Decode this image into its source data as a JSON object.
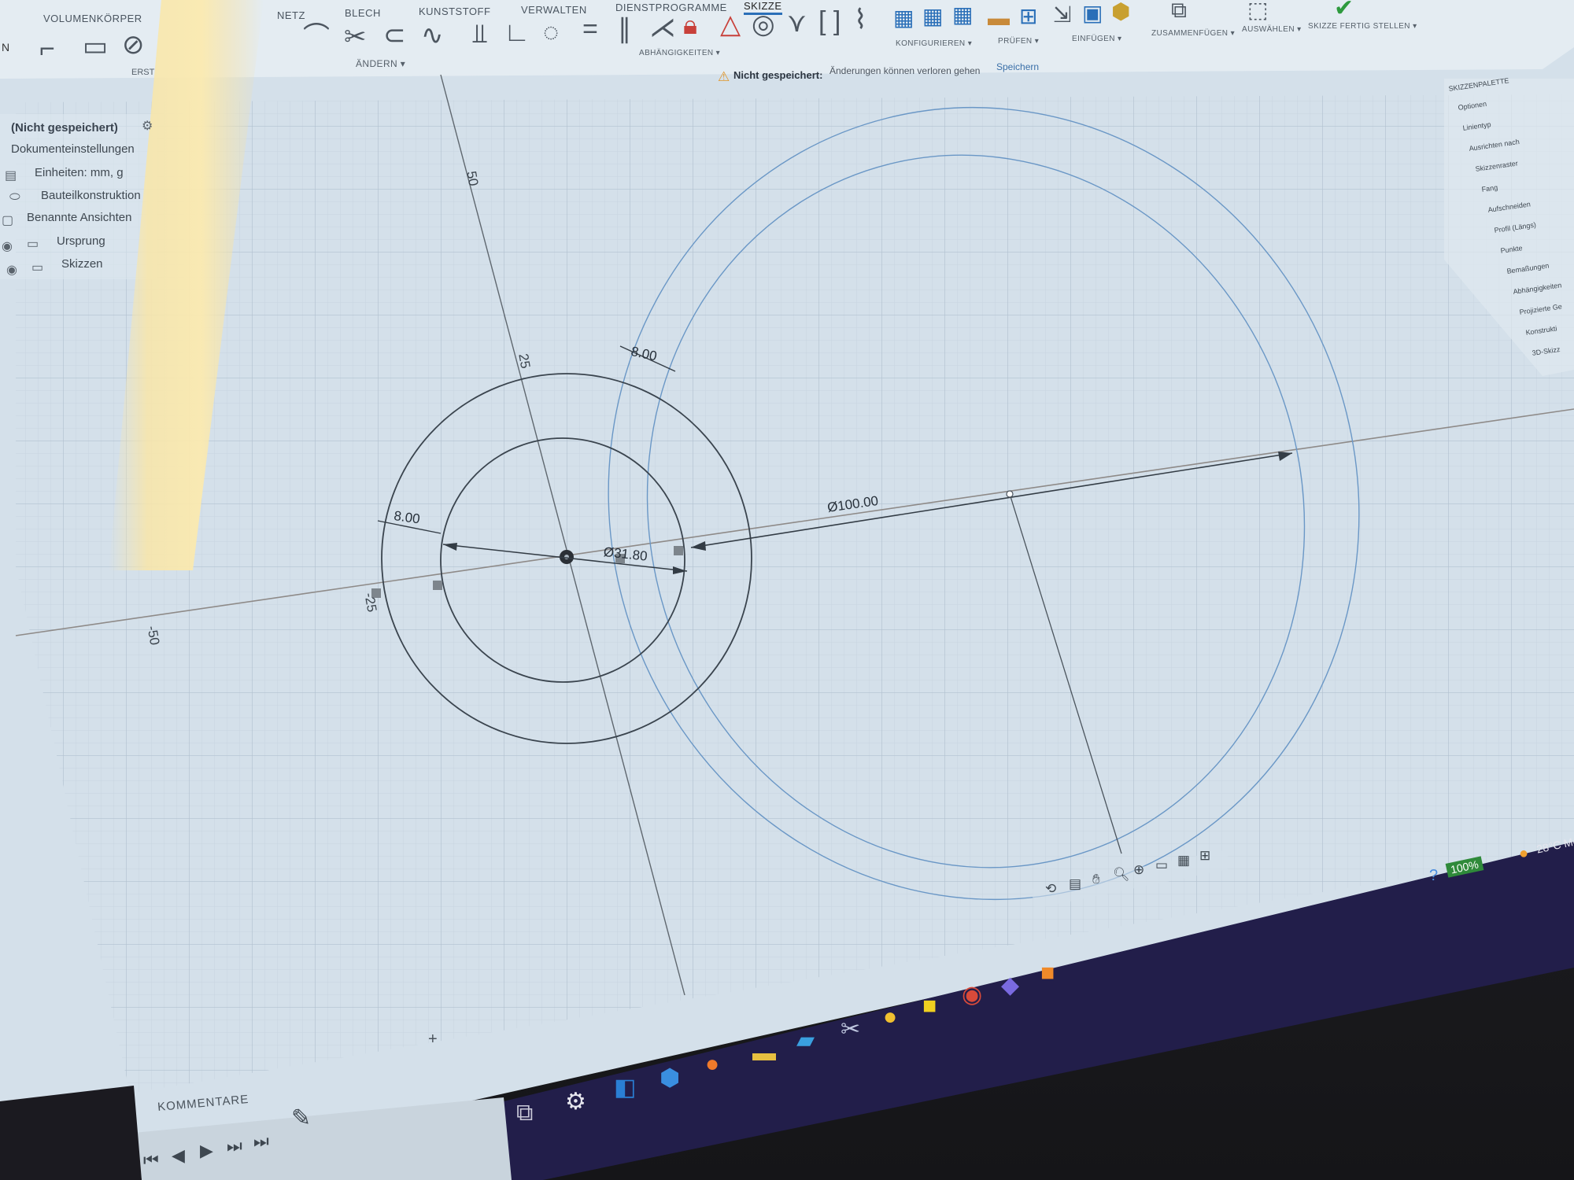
{
  "app": {
    "tabs": [
      "NETZ",
      "BLECH",
      "KUNSTSTOFF",
      "VERWALTEN",
      "DIENSTPROGRAMME",
      "SKIZZE"
    ],
    "active_tab": "SKIZZE",
    "left_tab_label": "VOLUMENKÖRPER",
    "left_group": "ERST",
    "mode_button": "N"
  },
  "toolbar": {
    "groups": {
      "aendern": "ÄNDERN ▾",
      "abhaengigkeiten": "ABHÄNGIGKEITEN ▾",
      "konfigurieren": "KONFIGURIEREN ▾",
      "pruefen": "PRÜFEN ▾",
      "einfuegen": "EINFÜGEN ▾",
      "zusammenfuegen": "ZUSAMMENFÜGEN ▾",
      "auswaehlen": "AUSWÄHLEN ▾",
      "skizze_fertig": "SKIZZE FERTIG STELLEN ▾"
    }
  },
  "notice": {
    "label": "Nicht gespeichert:",
    "message": "Änderungen können verloren gehen",
    "action": "Speichern"
  },
  "browser": {
    "document": "(Nicht gespeichert)",
    "items": [
      "Dokumenteinstellungen",
      "Einheiten: mm, g",
      "Bauteilkonstruktion",
      "Benannte Ansichten",
      "Ursprung",
      "Skizzen"
    ]
  },
  "palette": {
    "title": "SKIZZENPALETTE",
    "section": "Optionen",
    "items": [
      "Linientyp",
      "Ausrichten nach",
      "Skizzenraster",
      "Fang",
      "Aufschneiden",
      "Profil (Längs)",
      "Punkte",
      "Bemaßungen",
      "Abhängigkeiten",
      "Projizierte Ge",
      "Konstrukti",
      "3D-Skizz"
    ]
  },
  "sketch": {
    "dimensions": {
      "left_ring_width": "8.00",
      "top_ring_width": "8.00",
      "inner_diameter": "Ø31.80",
      "large_diameter": "Ø100.00"
    },
    "axis_labels": {
      "v50": "50",
      "v25": "25",
      "hneg25": "-25",
      "hneg50": "-50"
    }
  },
  "timeline": {
    "comments_label": "KOMMENTARE",
    "plus": "+"
  },
  "status": {
    "battery": "100%",
    "weather": "28°C Me"
  },
  "colors": {
    "canvas_bg": "#d6e2ec",
    "grid_minor": "#c4d2de",
    "grid_major": "#aebfcd",
    "sketch_line": "#3a444e",
    "selected_line": "#5d8fc4",
    "accent": "#2a6fb8",
    "taskbar": "#231f4e"
  }
}
